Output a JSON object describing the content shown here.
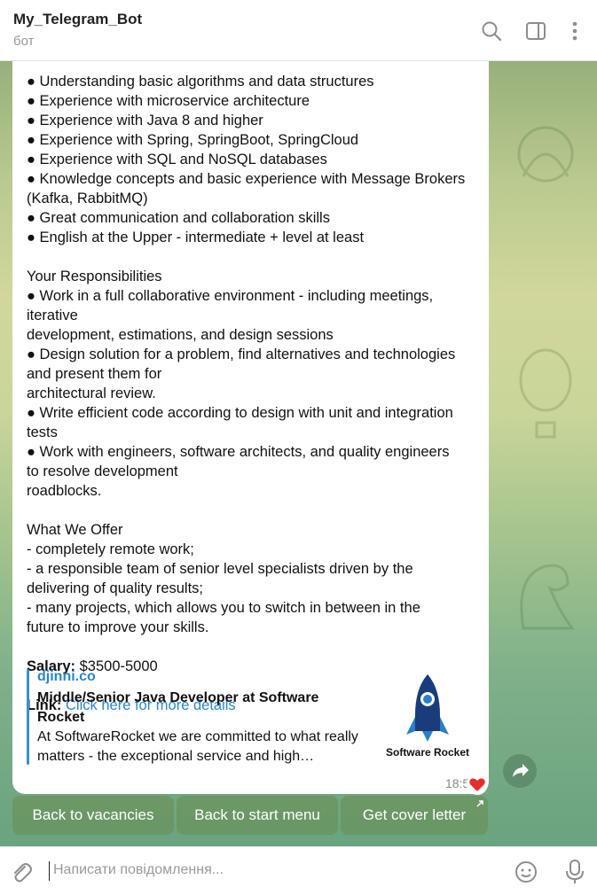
{
  "header": {
    "title": "My_Telegram_Bot",
    "subtitle": "бот",
    "icons": [
      "search-icon",
      "sidebar-toggle-icon",
      "more-vert-icon"
    ]
  },
  "message": {
    "lines": [
      "● Understanding basic algorithms and data structures",
      "● Experience with microservice architecture",
      "● Experience with Java 8 and higher",
      "● Experience with Spring, SpringBoot, SpringCloud",
      "● Experience with SQL and NoSQL databases",
      "● Knowledge concepts and basic experience with Message Brokers",
      "(Kafka, RabbitMQ)",
      "● Great communication and collaboration skills",
      "● English at the Upper - intermediate + level at least",
      "",
      "Your Responsibilities",
      "● Work in a full collaborative environment - including meetings,",
      "iterative",
      "development, estimations, and design sessions",
      "● Design solution for a problem, find alternatives and technologies",
      "and present them for",
      "architectural review.",
      "● Write efficient code according to design with unit and integration",
      "tests",
      "● Work with engineers, software architects, and quality engineers",
      "to resolve development",
      "roadblocks.",
      "",
      "What We Offer",
      "- completely remote work;",
      "- a responsible team of senior level specialists driven by the",
      "delivering of quality results;",
      "- many projects, which allows you to switch in between in the",
      "future to improve your skills."
    ],
    "salary_label": "Salary:",
    "salary_value": " $3500-5000",
    "link_label": "Link:",
    "link_text": "Click here for more details",
    "time": "18:58",
    "reaction": "❤"
  },
  "preview": {
    "site": "djinni.co",
    "title": "Middle/Senior Java Developer at Software Rocket",
    "description": "At SoftwareRocket we are committed to what really matters - the exceptional service and high…",
    "thumb_caption": "Software Rocket",
    "thumb_icon": "rocket-logo"
  },
  "keyboard": {
    "buttons": [
      "Back to vacancies",
      "Back to start menu",
      "Get cover letter"
    ]
  },
  "input": {
    "placeholder": "Написати повідомлення..."
  },
  "colors": {
    "accent": "#2a86c8",
    "bubble": "#ffffff",
    "keyboard_button": "#698c50"
  }
}
